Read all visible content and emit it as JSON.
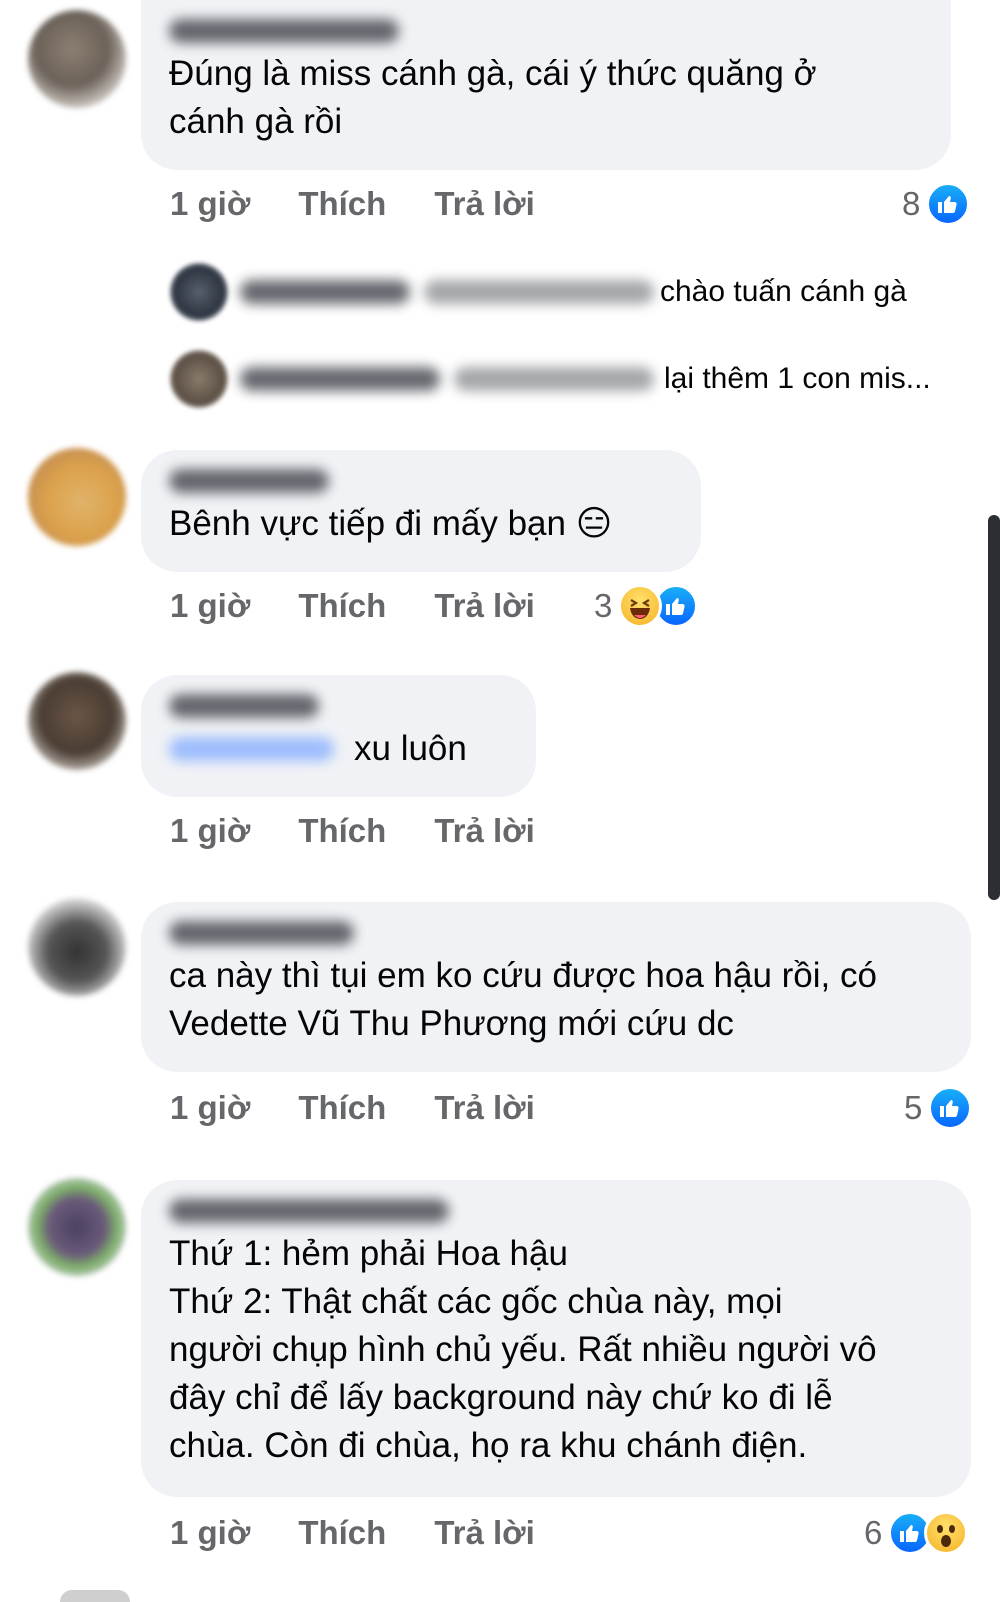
{
  "theme": {
    "like_blue": "#0866ff",
    "bubble_bg": "#f0f2f5",
    "meta_gray": "#65676b"
  },
  "comments": [
    {
      "text": "Đúng là miss cánh gà, cái ý thức quăng ở\ncánh gà rồi",
      "time": "1 giờ",
      "like_label": "Thích",
      "reply_label": "Trả lời",
      "reaction_count": "8",
      "reactions": [
        "like-icon"
      ]
    },
    {
      "text": "Bênh vực tiếp đi mấy bạn 😑",
      "time": "1 giờ",
      "like_label": "Thích",
      "reply_label": "Trả lời",
      "reaction_count": "3",
      "reactions": [
        "haha-icon",
        "like-icon"
      ]
    },
    {
      "text": "xu luôn",
      "time": "1 giờ",
      "like_label": "Thích",
      "reply_label": "Trả lời"
    },
    {
      "text": "ca này thì tụi em ko cứu được hoa hậu rồi, có\nVedette Vũ Thu Phương mới cứu dc",
      "time": "1 giờ",
      "like_label": "Thích",
      "reply_label": "Trả lời",
      "reaction_count": "5",
      "reactions": [
        "like-icon"
      ]
    },
    {
      "text": "Thứ 1: hẻm phải Hoa hậu\nThứ 2: Thật chất các gốc chùa này, mọi\nngười chụp hình chủ yếu. Rất nhiều người vô\nđây chỉ để lấy background này chứ ko đi lễ\nchùa. Còn đi chùa, họ ra khu chánh điện.",
      "time": "1 giờ",
      "like_label": "Thích",
      "reply_label": "Trả lời",
      "reaction_count": "6",
      "reactions": [
        "like-icon",
        "wow-icon"
      ]
    }
  ],
  "replies": [
    {
      "text": "chào tuấn cánh gà"
    },
    {
      "text": "lại thêm 1 con mis..."
    }
  ]
}
